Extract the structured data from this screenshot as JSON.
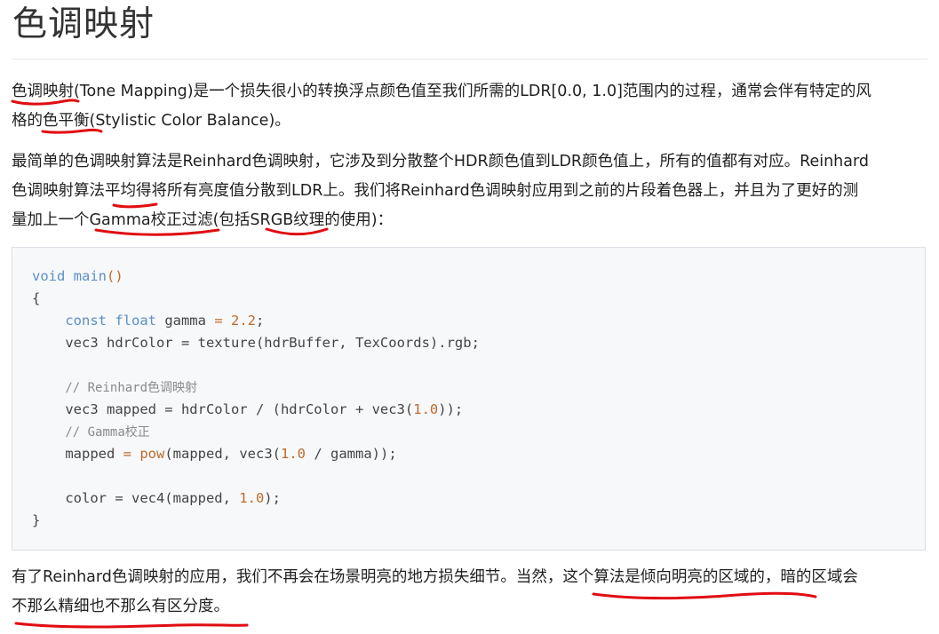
{
  "heading": "色调映射",
  "paragraph1": {
    "line1": "色调映射(Tone Mapping)是一个损失很小的转换浮点颜色值至我们所需的LDR[0.0, 1.0]范围内的过程，通常会伴有特定的风",
    "line2": "格的色平衡(Stylistic Color Balance)。"
  },
  "paragraph2": {
    "line1": "最简单的色调映射算法是Reinhard色调映射，它涉及到分散整个HDR颜色值到LDR颜色值上，所有的值都有对应。Reinhard",
    "line2": "色调映射算法平均得将所有亮度值分散到LDR上。我们将Reinhard色调映射应用到之前的片段着色器上，并且为了更好的测",
    "line3": "量加上一个Gamma校正过滤(包括SRGB纹理的使用)："
  },
  "code": {
    "l1_kw": "void",
    "l1_fn": "main",
    "l1_paren": "()",
    "l2": "{",
    "l3_kw": "const float",
    "l3_var": " gamma ",
    "l3_op": "=",
    "l3_num": "2.2",
    "l3_end": ";",
    "l4": "vec3 hdrColor = texture(hdrBuffer, TexCoords).rgb;",
    "l6_comment": "// Reinhard色调映射",
    "l7_a": "vec3 mapped = hdrColor / (hdrColor + vec3(",
    "l7_num": "1.0",
    "l7_b": "));",
    "l8_comment": "// Gamma校正",
    "l9_a": "mapped ",
    "l9_op": "=",
    "l9_fn": "pow",
    "l9_b": "(mapped, vec3(",
    "l9_num": "1.0",
    "l9_c": " / gamma));",
    "l11_a": "color = vec4(mapped, ",
    "l11_num": "1.0",
    "l11_b": ");",
    "l12": "}"
  },
  "paragraph3": {
    "line1": "有了Reinhard色调映射的应用，我们不再会在场景明亮的地方损失细节。当然，这个算法是倾向明亮的区域的，暗的区域会",
    "line2": "不那么精细也不那么有区分度。"
  },
  "colors": {
    "annotation": "#e00d12",
    "keyword": "#5b8fc7",
    "number": "#c0692a",
    "comment": "#8a8a8a"
  }
}
